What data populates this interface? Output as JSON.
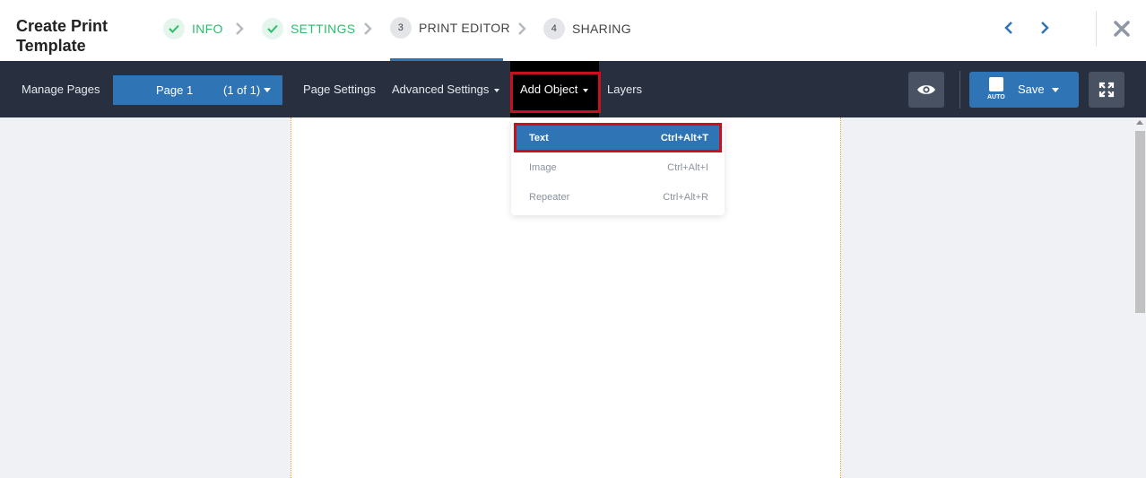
{
  "header": {
    "title": "Create Print Template",
    "steps": [
      {
        "label": "INFO",
        "state": "done"
      },
      {
        "label": "SETTINGS",
        "state": "done"
      },
      {
        "label": "PRINT EDITOR",
        "number": "3",
        "state": "active"
      },
      {
        "label": "SHARING",
        "number": "4",
        "state": "pending"
      }
    ]
  },
  "toolbar": {
    "manage_pages": "Manage Pages",
    "page_select": {
      "label": "Page 1",
      "count": "(1 of 1)"
    },
    "page_settings": "Page Settings",
    "advanced_settings": "Advanced Settings",
    "add_object": "Add Object",
    "layers": "Layers",
    "save": {
      "auto_label": "AUTO",
      "label": "Save"
    }
  },
  "add_object_menu": {
    "items": [
      {
        "label": "Text",
        "shortcut": "Ctrl+Alt+T",
        "state": "highlighted"
      },
      {
        "label": "Image",
        "shortcut": "Ctrl+Alt+I",
        "state": "disabled"
      },
      {
        "label": "Repeater",
        "shortcut": "Ctrl+Alt+R",
        "state": "disabled"
      }
    ]
  },
  "colors": {
    "accent_blue": "#2f75b5",
    "toolbar_bg": "#283040",
    "success_green": "#2ebc6d",
    "highlight_red": "#c8101f"
  }
}
